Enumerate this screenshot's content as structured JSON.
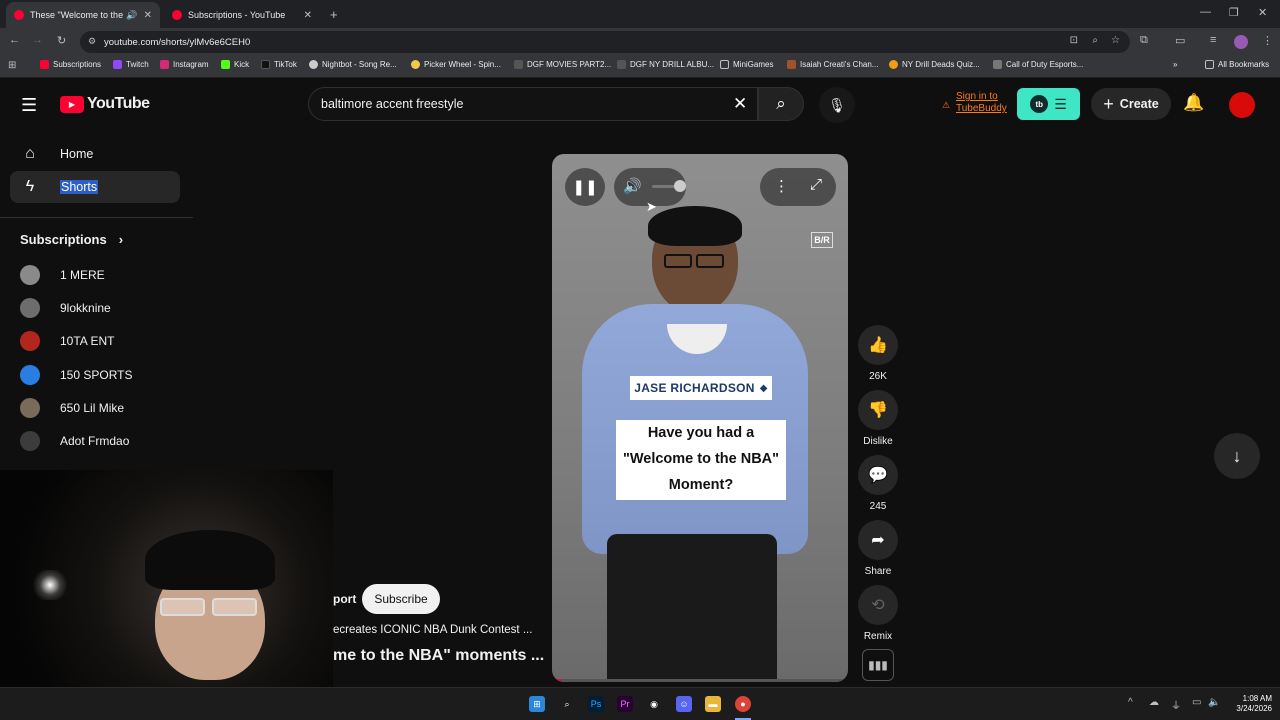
{
  "browser": {
    "tabs": [
      {
        "title": "These \"Welcome to the NBA",
        "active": true
      },
      {
        "title": "Subscriptions - YouTube",
        "active": false
      }
    ],
    "url": "youtube.com/shorts/ylMv6e6CEH0",
    "bookmarks": [
      "Subscriptions",
      "Twitch",
      "Instagram",
      "Kick",
      "TikTok",
      "Nightbot - Song Re...",
      "Picker Wheel - Spin...",
      "DGF MOVIES PART2...",
      "DGF NY DRILL ALBU...",
      "MiniGames",
      "Isaiah Creati's Chan...",
      "NY Drill Deads Quiz...",
      "Call of Duty Esports..."
    ],
    "all_bookmarks": "All Bookmarks"
  },
  "youtube": {
    "logo_text": "YouTube",
    "search_value": "baltimore accent freestyle",
    "tubebuddy": "Sign in to TubeBuddy",
    "create_label": "Create",
    "sidebar": {
      "home": "Home",
      "shorts": "Shorts",
      "subscriptions_header": "Subscriptions",
      "subscriptions": [
        "1 MERE",
        "9lokknine",
        "10TA ENT",
        "150 SPORTS",
        "650 Lil Mike",
        "Adot Frmdao"
      ]
    },
    "short": {
      "brand_badge": "B/R",
      "name_tag": "JASE RICHARDSON",
      "caption": [
        "Have you had a",
        "\"Welcome to the NBA\"",
        "Moment?"
      ],
      "channel_partial": "port",
      "subscribe_label": "Subscribe",
      "desc_partial": "ecreates ICONIC NBA Dunk Contest ...",
      "title_partial": "me to the NBA\" moments ..."
    },
    "actions": {
      "likes": "26K",
      "dislike": "Dislike",
      "comments": "245",
      "share": "Share",
      "remix": "Remix"
    }
  },
  "system": {
    "time": "1:08 AM",
    "date": "3/24/2026"
  }
}
